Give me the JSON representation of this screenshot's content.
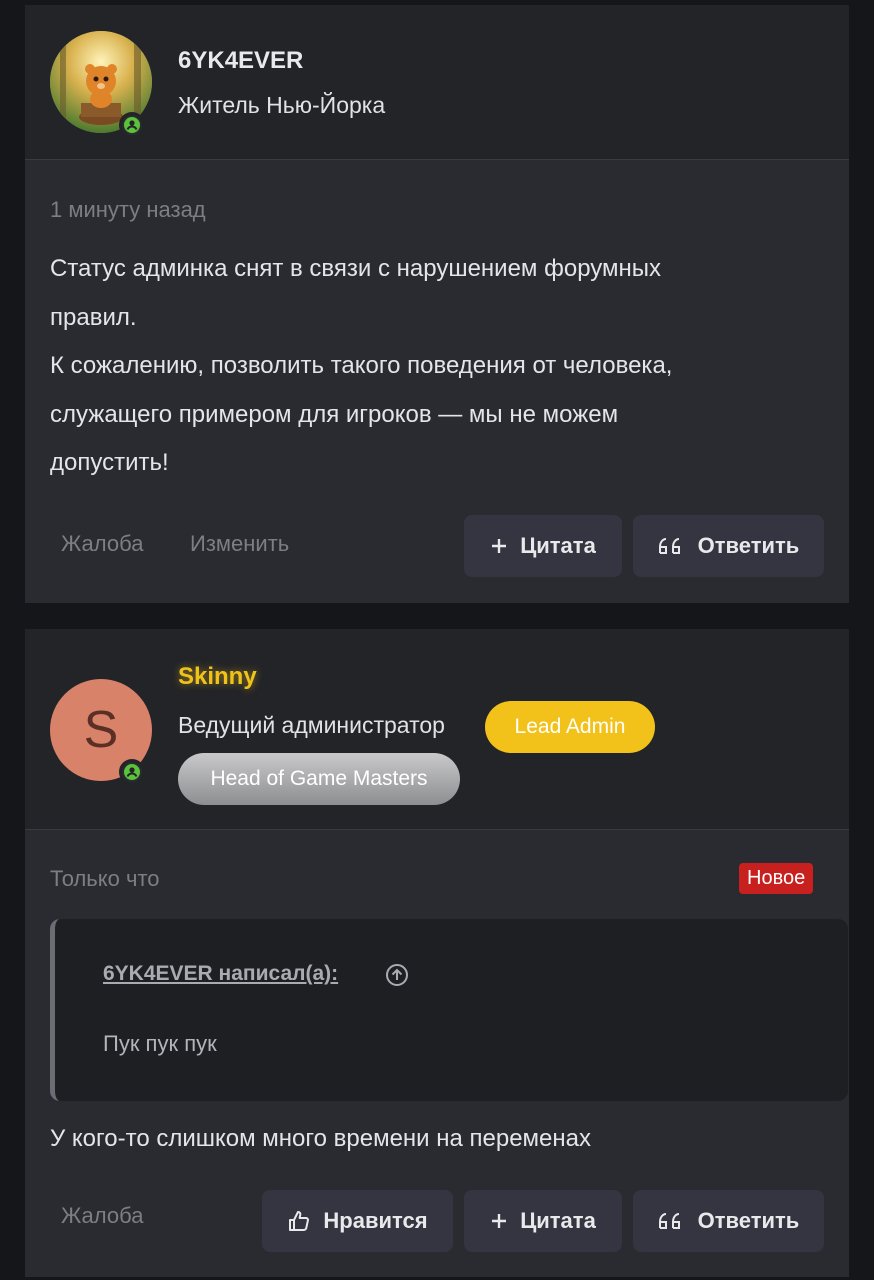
{
  "post1": {
    "username": "6YK4EVER",
    "user_title": "Житель Нью-Йорка",
    "timestamp": "1 минуту назад",
    "message_lines": [
      "Статус админка снят в связи с нарушением форумных",
      "правил.",
      "К сожалению, позволить такого поведения от человека,",
      "служащего примером для игроков — мы не можем",
      "допустить!"
    ],
    "actions": {
      "report": "Жалоба",
      "edit": "Изменить",
      "quote": "Цитата",
      "reply": "Ответить"
    }
  },
  "post2": {
    "username": "Skinny",
    "avatar_letter": "S",
    "user_title": "Ведущий администратор",
    "badges": [
      "Lead Admin",
      "Head of Game Masters"
    ],
    "timestamp": "Только что",
    "new_label": "Новое",
    "quote": {
      "author": "6YK4EVER написал(а):",
      "text": "Пук пук пук"
    },
    "message": "У кого-то слишком много времени на переменах",
    "actions": {
      "report": "Жалоба",
      "like": "Нравится",
      "quote": "Цитата",
      "reply": "Ответить"
    }
  },
  "colors": {
    "username_highlight": "#f0c31a",
    "lead_badge": "#f2c21a",
    "new_badge": "#c8201e",
    "online": "#5cc23a"
  },
  "icons": [
    "online-status-icon",
    "plus-icon",
    "quote-marks-icon",
    "thumbs-up-icon",
    "arrow-up-circle-icon"
  ]
}
